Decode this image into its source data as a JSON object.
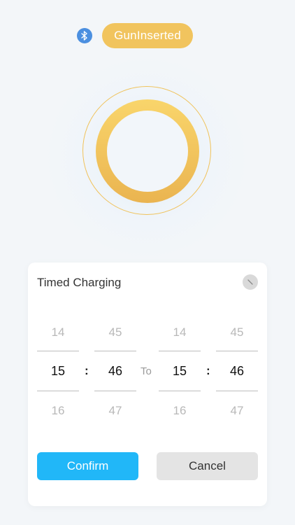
{
  "status": {
    "connection_icon": "bluetooth-icon",
    "badge_text": "GunInserted",
    "badge_color": "#f1c45e"
  },
  "dialog": {
    "title": "Timed Charging",
    "close_icon": "close-icon",
    "start": {
      "hour": {
        "prev": "14",
        "selected": "15",
        "next": "16"
      },
      "minute": {
        "prev": "45",
        "selected": "46",
        "next": "47"
      }
    },
    "separator": ":",
    "to_label": "To",
    "end": {
      "hour": {
        "prev": "14",
        "selected": "15",
        "next": "16"
      },
      "minute": {
        "prev": "45",
        "selected": "46",
        "next": "47"
      }
    },
    "confirm_label": "Confirm",
    "cancel_label": "Cancel",
    "confirm_color": "#21b7f8",
    "cancel_color": "#e4e4e4"
  }
}
